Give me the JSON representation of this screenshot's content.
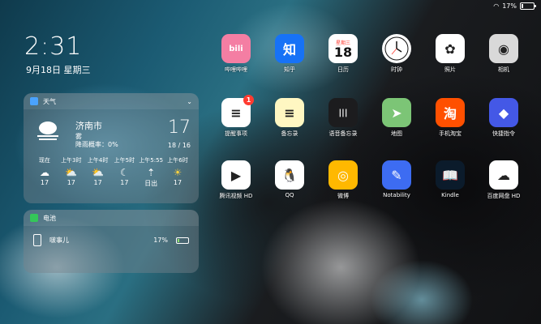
{
  "status": {
    "battery_pct": "17%",
    "wifi_icon": "wifi-icon",
    "battery_level": 0.17
  },
  "lockscreen": {
    "time": "2:31",
    "date": "9月18日 星期三"
  },
  "weather_widget": {
    "title": "天气",
    "city": "济南市",
    "condition": "雾",
    "rain_chance": "降雨概率：0%",
    "temp": "17",
    "hi_lo": "18 / 16",
    "forecast": [
      {
        "time": "现在",
        "icon": "fog-icon",
        "temp": "17"
      },
      {
        "time": "上午3时",
        "icon": "partly-cloudy-icon",
        "temp": "17"
      },
      {
        "time": "上午4时",
        "icon": "partly-cloudy-icon",
        "temp": "17"
      },
      {
        "time": "上午5时",
        "icon": "moon-cloud-icon",
        "temp": "17"
      },
      {
        "time": "上午5:55",
        "icon": "sunrise-icon",
        "temp": "日出"
      },
      {
        "time": "上午6时",
        "icon": "sun-icon",
        "temp": "17"
      }
    ]
  },
  "battery_widget": {
    "title": "电池",
    "device": "啵事儿",
    "pct": "17%",
    "level": 0.17
  },
  "apps": [
    {
      "label": "哔哩哔哩",
      "glyph": "bili",
      "bg": "#f47ea3",
      "icon": "bilibili-icon"
    },
    {
      "label": "知乎",
      "glyph": "知",
      "bg": "#1772f6",
      "icon": "zhihu-icon"
    },
    {
      "label": "日历",
      "glyph": "18",
      "bg": "#ffffff",
      "icon": "calendar-icon",
      "sub": "星期三"
    },
    {
      "label": "时钟",
      "glyph": "",
      "bg": "#ffffff",
      "icon": "clock-icon"
    },
    {
      "label": "照片",
      "glyph": "✿",
      "bg": "#ffffff",
      "icon": "photos-icon"
    },
    {
      "label": "相机",
      "glyph": "◉",
      "bg": "#d9d9d9",
      "icon": "camera-icon"
    },
    {
      "label": "提醒事项",
      "glyph": "≡",
      "bg": "#ffffff",
      "icon": "reminders-icon",
      "badge": "1"
    },
    {
      "label": "备忘录",
      "glyph": "≡",
      "bg": "#fff7c2",
      "icon": "notes-icon"
    },
    {
      "label": "语音备忘录",
      "glyph": "|||",
      "bg": "#1c1c1e",
      "icon": "voice-memos-icon"
    },
    {
      "label": "地图",
      "glyph": "➤",
      "bg": "#7cc576",
      "icon": "maps-icon"
    },
    {
      "label": "手机淘宝",
      "glyph": "淘",
      "bg": "#ff5000",
      "icon": "taobao-icon"
    },
    {
      "label": "快捷指令",
      "glyph": "◆",
      "bg": "#4458e6",
      "icon": "shortcuts-icon"
    },
    {
      "label": "腾讯视频 HD",
      "glyph": "▶",
      "bg": "#ffffff",
      "icon": "tencent-video-icon"
    },
    {
      "label": "QQ",
      "glyph": "🐧",
      "bg": "#ffffff",
      "icon": "qq-icon"
    },
    {
      "label": "微博",
      "glyph": "◎",
      "bg": "#ffb800",
      "icon": "weibo-icon"
    },
    {
      "label": "Notability",
      "glyph": "✎",
      "bg": "#3d6cf2",
      "icon": "notability-icon"
    },
    {
      "label": "Kindle",
      "glyph": "📖",
      "bg": "#0b1b2b",
      "icon": "kindle-icon"
    },
    {
      "label": "百度网盘 HD",
      "glyph": "☁",
      "bg": "#ffffff",
      "icon": "baidu-netdisk-icon"
    }
  ]
}
